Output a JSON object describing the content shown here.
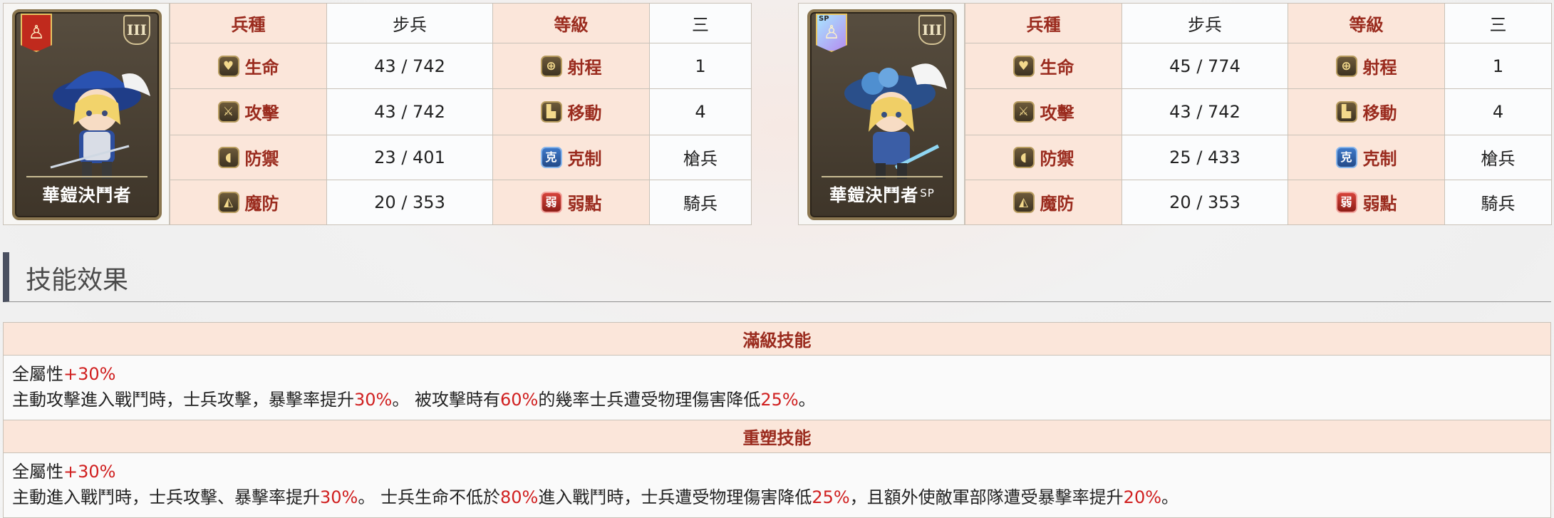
{
  "units": [
    {
      "name": "華鎧決鬥者",
      "name_sup": "",
      "rank": "III",
      "faction_variant": "normal",
      "labels": {
        "type": "兵種",
        "level": "等級",
        "hp": "生命",
        "range": "射程",
        "atk": "攻擊",
        "move": "移動",
        "def": "防禦",
        "counter": "克制",
        "mdef": "魔防",
        "weak": "弱點"
      },
      "type": "步兵",
      "level": "三",
      "hp": {
        "a": "43",
        "sep": " / ",
        "b": "742",
        "highlight": false
      },
      "atk": {
        "a": "43",
        "sep": " / ",
        "b": "742",
        "highlight": false
      },
      "def": {
        "a": "23",
        "sep": " / ",
        "b": "401",
        "highlight": false
      },
      "mdef": {
        "a": "20",
        "sep": " / ",
        "b": "353",
        "highlight": false
      },
      "range": "1",
      "move": "4",
      "counter": "槍兵",
      "weak": "騎兵"
    },
    {
      "name": "華鎧決鬥者",
      "name_sup": "SP",
      "rank": "III",
      "faction_variant": "sp",
      "labels": {
        "type": "兵種",
        "level": "等級",
        "hp": "生命",
        "range": "射程",
        "atk": "攻擊",
        "move": "移動",
        "def": "防禦",
        "counter": "克制",
        "mdef": "魔防",
        "weak": "弱點"
      },
      "type": "步兵",
      "level": "三",
      "hp": {
        "a": "45",
        "sep": " / ",
        "b": "774",
        "highlight": true
      },
      "atk": {
        "a": "43",
        "sep": " / ",
        "b": "742",
        "highlight": false
      },
      "def": {
        "a": "25",
        "sep": " / ",
        "b": "433",
        "highlight": true
      },
      "mdef": {
        "a": "20",
        "sep": " / ",
        "b": "353",
        "highlight": false
      },
      "range": "1",
      "move": "4",
      "counter": "槍兵",
      "weak": "騎兵"
    }
  ],
  "icons": {
    "hp": "heart-icon",
    "atk": "sword-icon",
    "def": "shield-icon",
    "mdef": "magic-defense-icon",
    "range": "range-target-icon",
    "move": "boot-icon",
    "counter": "counter-icon",
    "weak": "weakness-icon"
  },
  "icon_glyphs": {
    "counter": "克",
    "weak": "弱"
  },
  "colors": {
    "label_bg": "#fbe6da",
    "label_text": "#9a2b1e",
    "highlight_red": "#d01f1f",
    "stat_red": "#b03a2e",
    "heading_bar": "#4a5060"
  },
  "section": {
    "title": "技能效果"
  },
  "skills": [
    {
      "title": "滿級技能",
      "line1": [
        "全屬性",
        "+30%"
      ],
      "line2": [
        "主動攻擊進入戰鬥時，士兵攻擊，暴擊率提升",
        "30%",
        "。 被攻擊時有",
        "60%",
        "的幾率士兵遭受物理傷害降低",
        "25%",
        "。"
      ]
    },
    {
      "title": "重塑技能",
      "line1": [
        "全屬性",
        "+30%"
      ],
      "line2": [
        "主動進入戰鬥時，士兵攻擊、暴擊率提升",
        "30%",
        "。 士兵生命不低於",
        "80%",
        "進入戰鬥時，士兵遭受物理傷害降低",
        "25%",
        "，且額外使敵軍部隊遭受暴擊率提升",
        "20%",
        "。"
      ]
    }
  ]
}
